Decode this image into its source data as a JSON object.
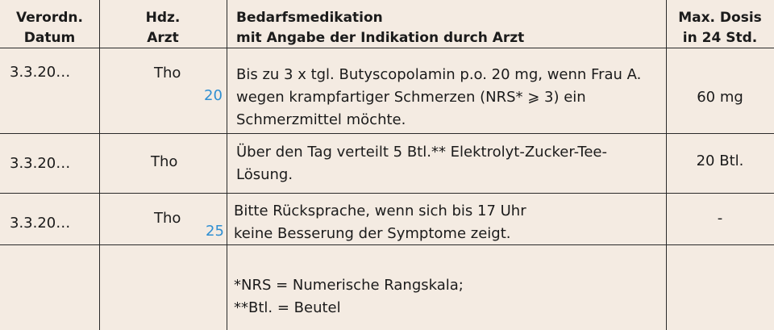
{
  "header": {
    "datum": [
      "Verordn.",
      "Datum"
    ],
    "arzt": [
      "Hdz.",
      "Arzt"
    ],
    "bedarf": [
      "Bedarfsmedikation",
      "mit Angabe der Indikation durch Arzt"
    ],
    "dosis": [
      "Max. Dosis",
      "in 24 Std."
    ]
  },
  "rows": [
    {
      "datum": "3.3.20…",
      "arzt": "Tho",
      "line_number": "20",
      "text": [
        "Bis zu 3 x tgl. Butyscopolamin p.o. 20 mg, wenn Frau A.",
        "wegen krampfartiger Schmerzen (NRS* ⩾ 3) ein",
        "Schmerzmittel möchte."
      ],
      "dosis": "60 mg"
    },
    {
      "datum": "3.3.20…",
      "arzt": "Tho",
      "text": [
        "Über den Tag verteilt 5 Btl.** Elektrolyt-Zucker-Tee-",
        "Lösung."
      ],
      "dosis": "20 Btl."
    },
    {
      "datum": "3.3.20…",
      "arzt": "Tho",
      "line_number": "25",
      "text": [
        "Bitte Rücksprache, wenn sich bis 17 Uhr",
        "keine Besserung der Symptome zeigt."
      ],
      "dosis": "-"
    }
  ],
  "footnotes": [
    "*NRS = Numerische Rangskala;",
    "**Btl. = Beutel"
  ]
}
